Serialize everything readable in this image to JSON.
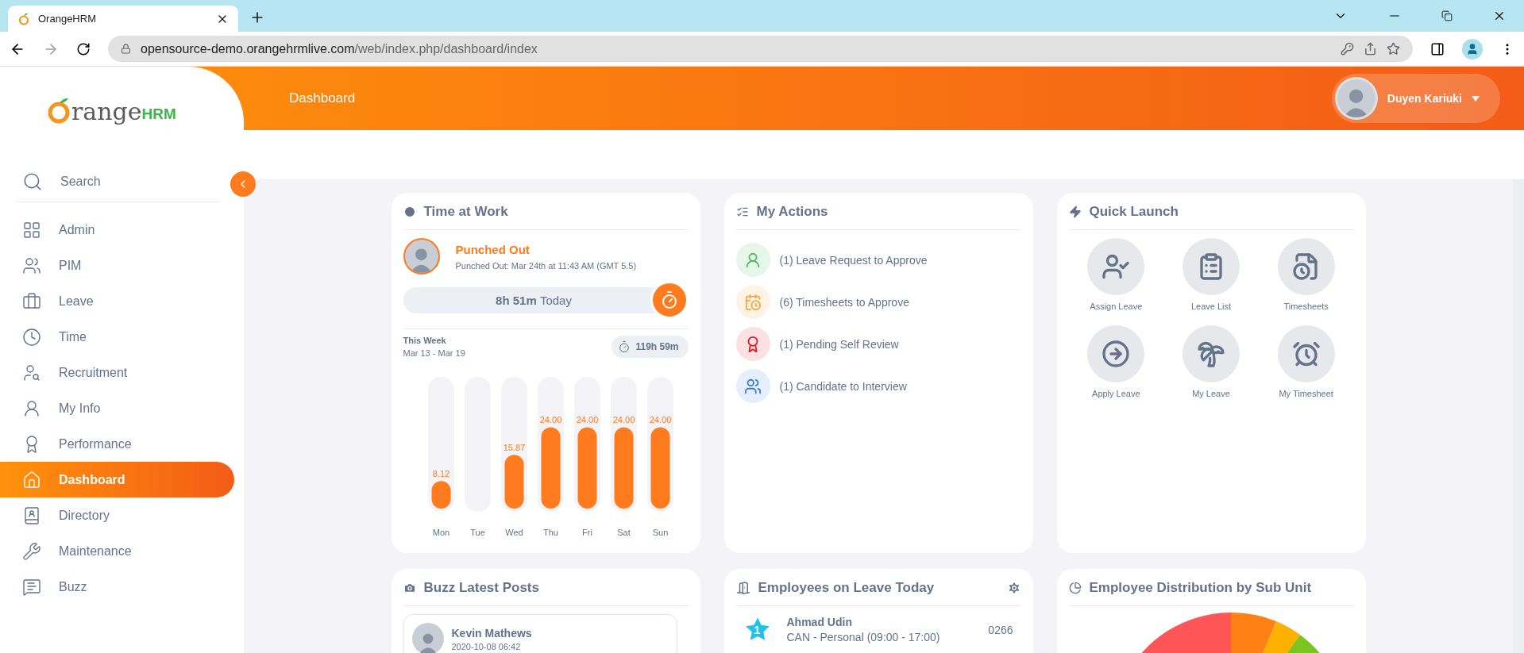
{
  "browser": {
    "tab_title": "OrangeHRM",
    "url_host": "opensource-demo.orangehrmlive.com",
    "url_path": "/web/index.php/dashboard/index"
  },
  "logo": {
    "name": "range",
    "suffix": "HRM"
  },
  "sidebar": {
    "search_placeholder": "Search",
    "items": [
      {
        "label": "Admin",
        "selected": false
      },
      {
        "label": "PIM",
        "selected": false
      },
      {
        "label": "Leave",
        "selected": false
      },
      {
        "label": "Time",
        "selected": false
      },
      {
        "label": "Recruitment",
        "selected": false
      },
      {
        "label": "My Info",
        "selected": false
      },
      {
        "label": "Performance",
        "selected": false
      },
      {
        "label": "Dashboard",
        "selected": true
      },
      {
        "label": "Directory",
        "selected": false
      },
      {
        "label": "Maintenance",
        "selected": false
      },
      {
        "label": "Buzz",
        "selected": false
      }
    ]
  },
  "header": {
    "title": "Dashboard",
    "user": "Duyen Kariuki"
  },
  "time_at_work": {
    "title": "Time at Work",
    "status": "Punched Out",
    "detail": "Punched Out: Mar 24th at 11:43 AM (GMT 5.5)",
    "today_hours": "8h 51m",
    "today_label": "Today",
    "week_label": "This Week",
    "week_range": "Mar 13 - Mar 19",
    "week_total": "119h 59m",
    "chart_data": {
      "type": "bar",
      "categories": [
        "Mon",
        "Tue",
        "Wed",
        "Thu",
        "Fri",
        "Sat",
        "Sun"
      ],
      "values": [
        8.12,
        null,
        15.87,
        24,
        24,
        24,
        24
      ],
      "value_labels": [
        "8.12",
        null,
        "15.87",
        "24.00",
        "24.00",
        "24.00",
        "24.00"
      ]
    }
  },
  "my_actions": {
    "title": "My Actions",
    "items": [
      {
        "label": "(1) Leave Request to Approve",
        "color": "#4cb963"
      },
      {
        "label": "(6) Timesheets to Approve",
        "color": "#f9a53c"
      },
      {
        "label": "(1) Pending Self Review",
        "color": "#e31b23"
      },
      {
        "label": "(1) Candidate to Interview",
        "color": "#3b7ddd"
      }
    ]
  },
  "quick_launch": {
    "title": "Quick Launch",
    "items": [
      {
        "label": "Assign Leave"
      },
      {
        "label": "Leave List"
      },
      {
        "label": "Timesheets"
      },
      {
        "label": "Apply Leave"
      },
      {
        "label": "My Leave"
      },
      {
        "label": "My Timesheet"
      }
    ]
  },
  "buzz": {
    "title": "Buzz Latest Posts",
    "posts": [
      {
        "author": "Kevin Mathews",
        "time": "2020-10-08 06:42"
      }
    ]
  },
  "leave_today": {
    "title": "Employees on Leave Today",
    "employees": [
      {
        "badge": "1",
        "name": "Ahmad Udin",
        "detail": "CAN - Personal (09:00 - 17:00)",
        "number": "0266"
      }
    ]
  },
  "distribution": {
    "title": "Employee Distribution by Sub Unit"
  }
}
